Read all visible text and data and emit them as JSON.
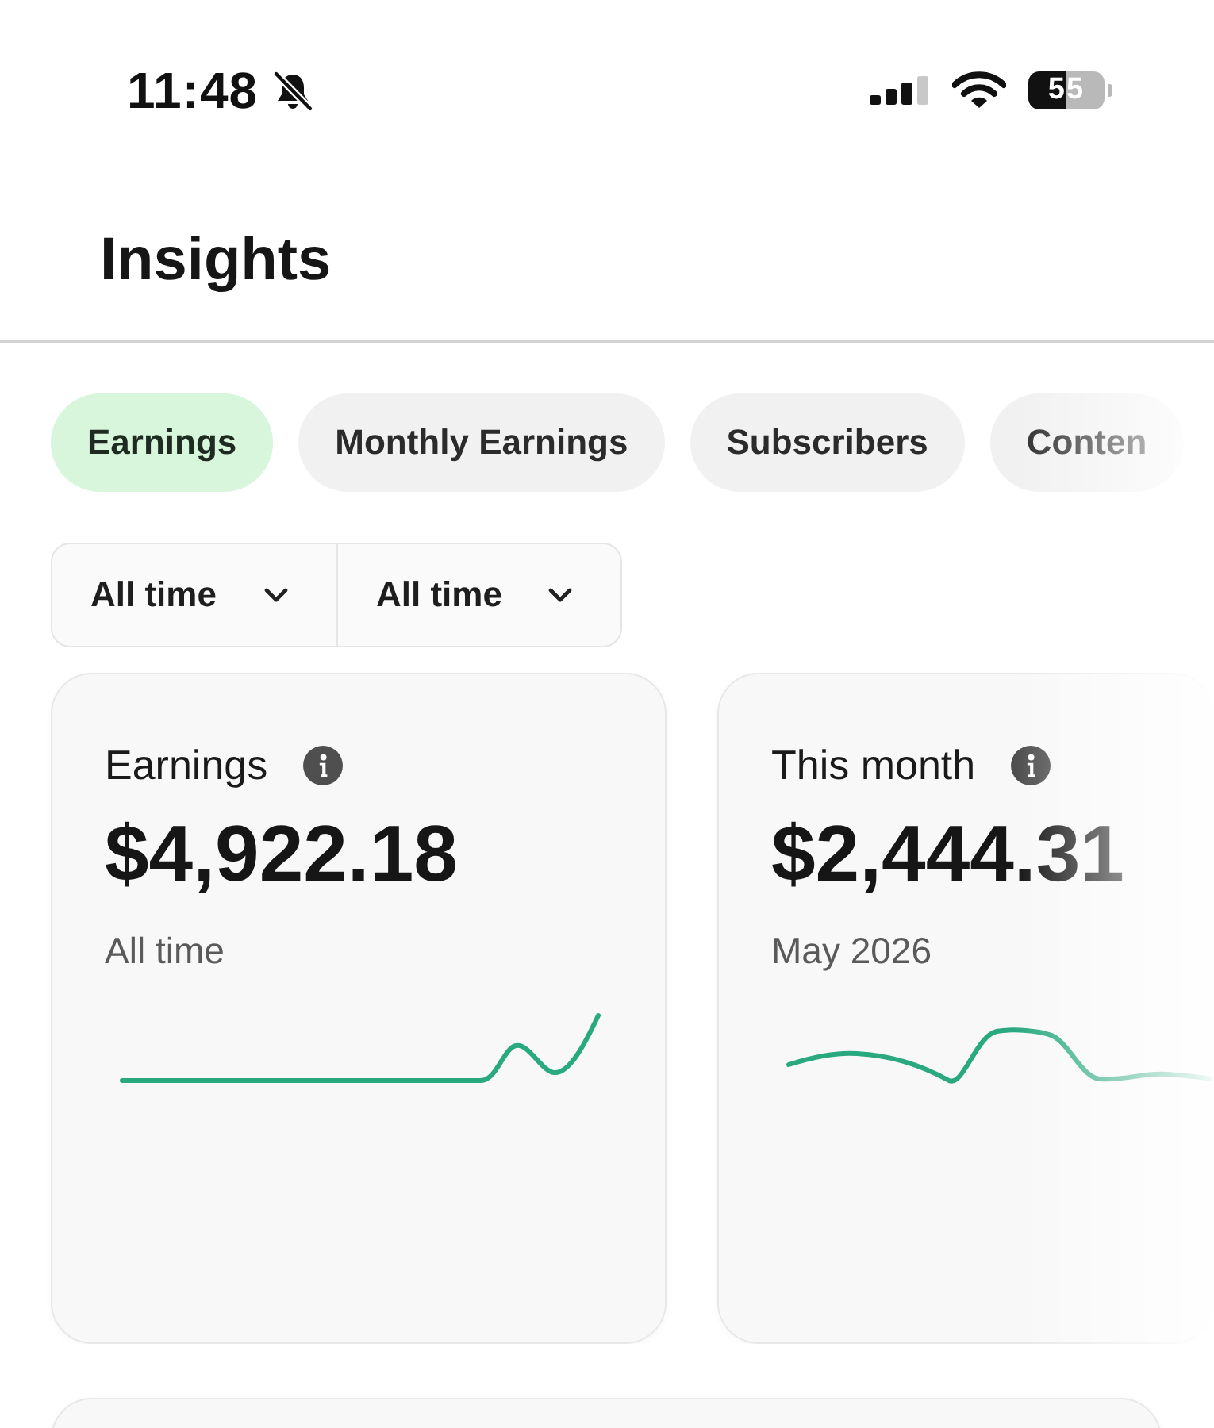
{
  "status_bar": {
    "time": "11:48",
    "battery": "55"
  },
  "header": {
    "title": "Insights"
  },
  "tabs": [
    {
      "label": "Earnings",
      "selected": true
    },
    {
      "label": "Monthly Earnings",
      "selected": false
    },
    {
      "label": "Subscribers",
      "selected": false
    },
    {
      "label": "Conten",
      "selected": false
    }
  ],
  "filters": [
    {
      "label": "All time"
    },
    {
      "label": "All time"
    }
  ],
  "cards": [
    {
      "title": "Earnings",
      "amount": "$4,922.18",
      "period": "All time"
    },
    {
      "title": "This month",
      "amount": "$2,444.31",
      "period": "May 2026"
    }
  ]
}
